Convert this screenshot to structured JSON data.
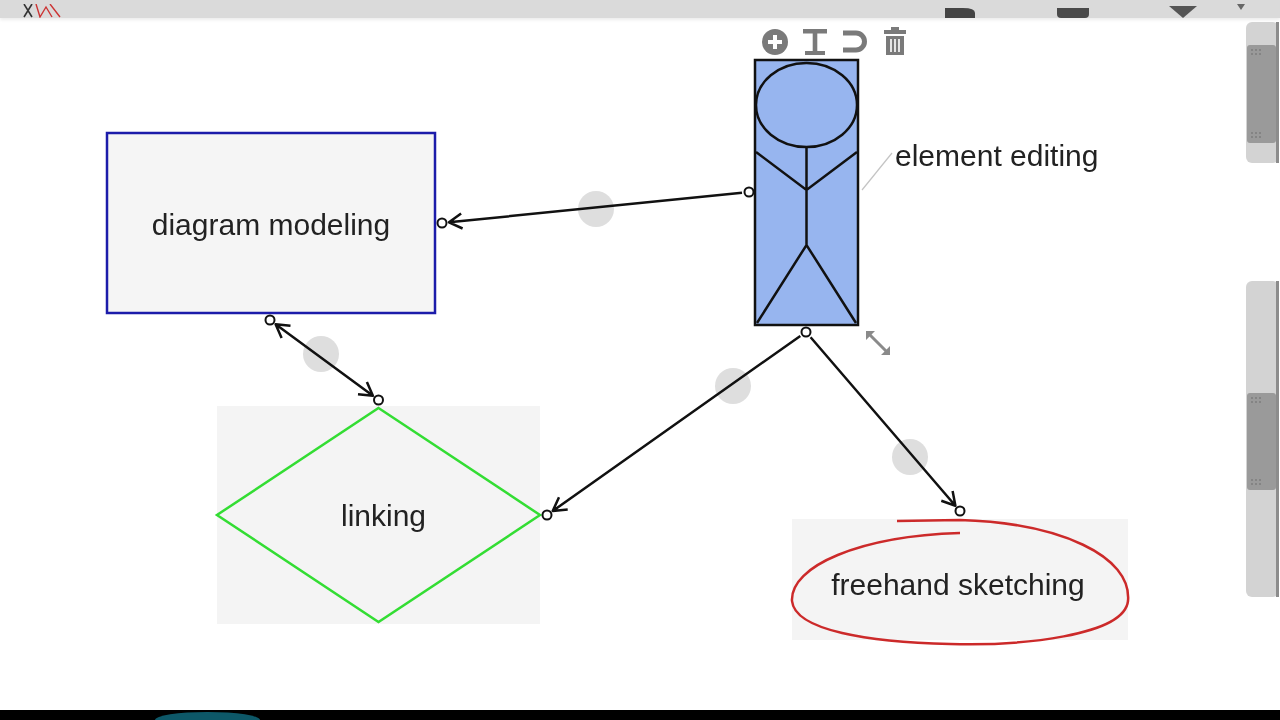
{
  "nodes": [
    {
      "kind": "rectangle",
      "label": "diagram modeling",
      "color": "#1c1caa",
      "selected": false
    },
    {
      "kind": "diamond",
      "label": "linking",
      "color": "#33dd33",
      "selected": false
    },
    {
      "kind": "actor",
      "color": "#97b5ef",
      "selected": true
    },
    {
      "kind": "freehand",
      "label": "freehand sketching",
      "color": "#cc2a2a",
      "selected": false
    }
  ],
  "callout": {
    "label": "element editing"
  }
}
